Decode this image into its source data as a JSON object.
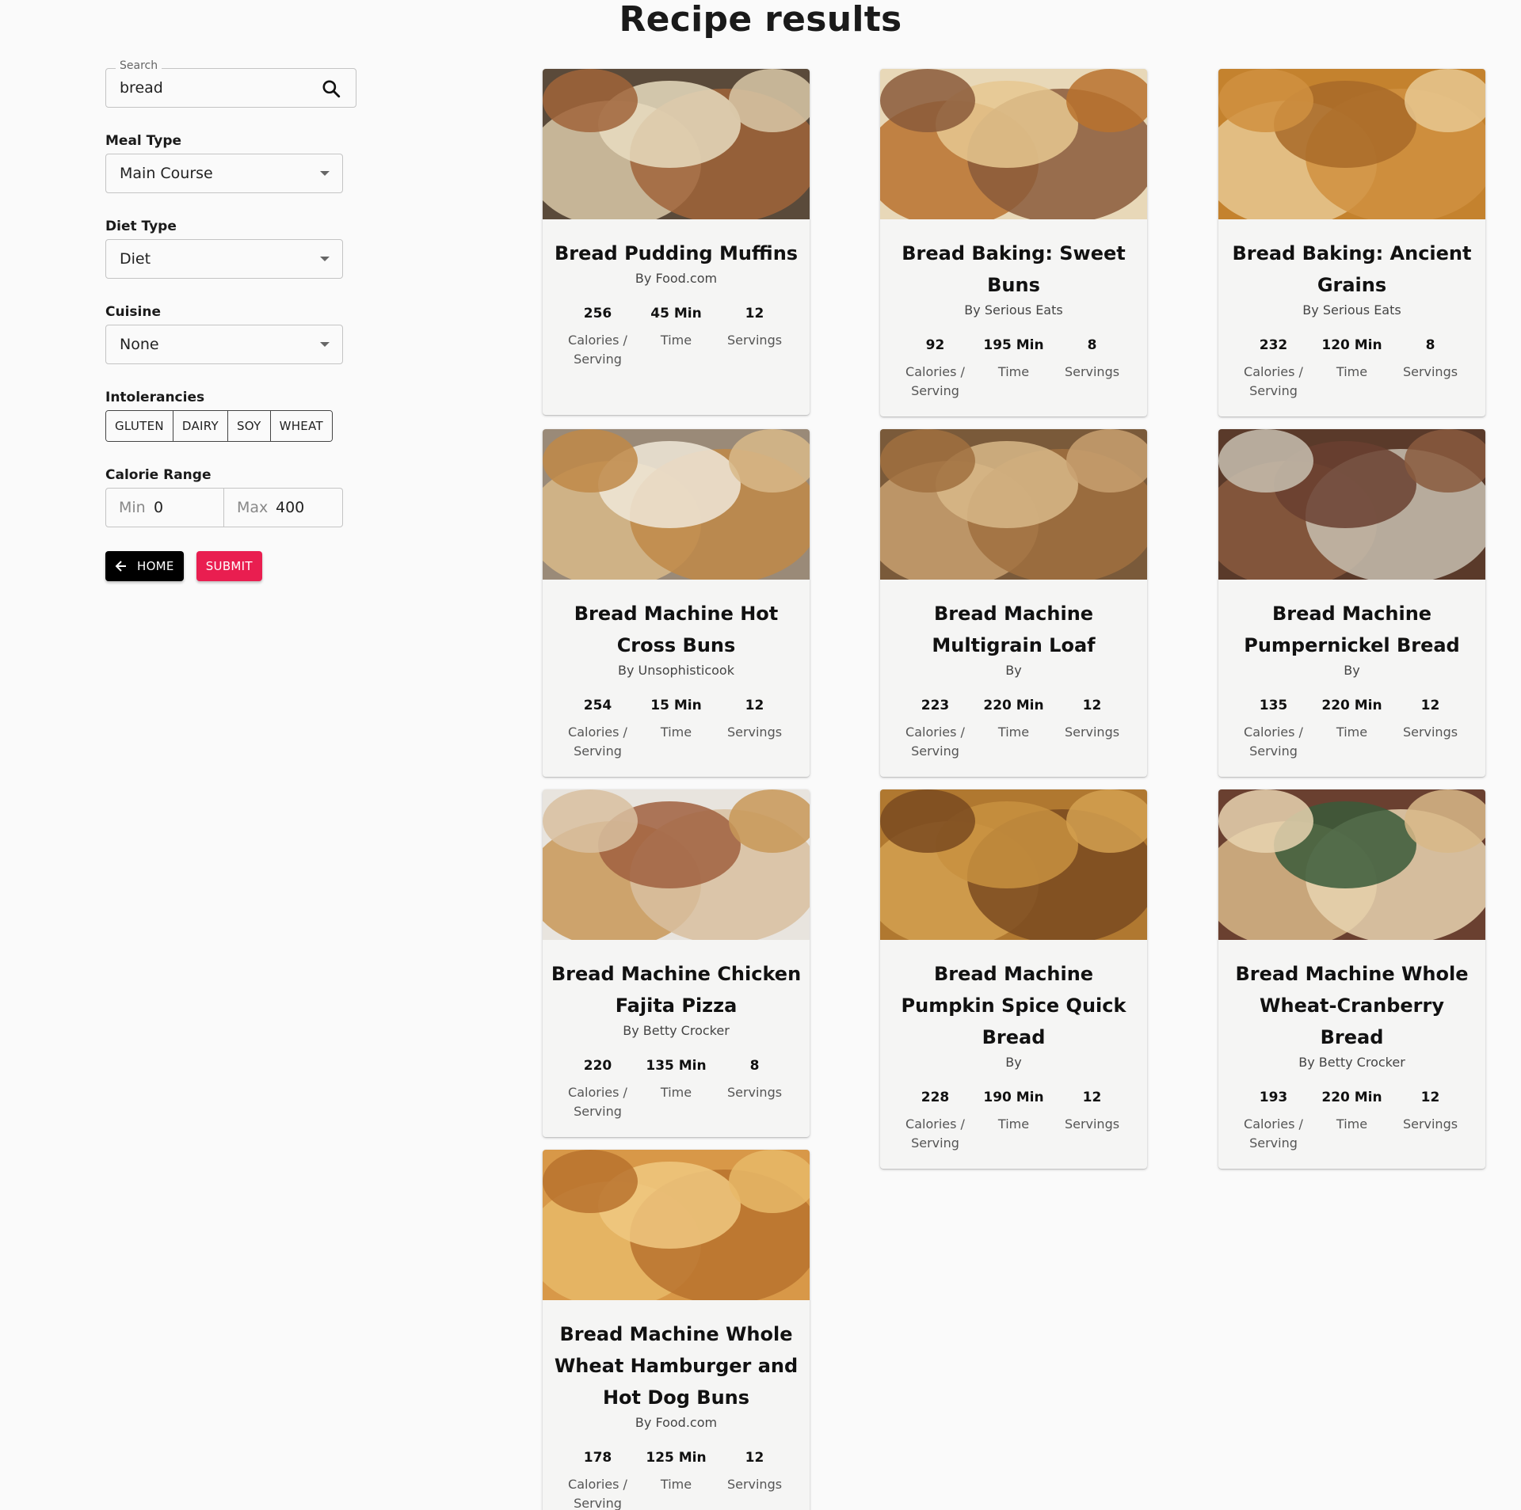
{
  "page": {
    "title": "Recipe results"
  },
  "search": {
    "legend": "Search",
    "value": "bread"
  },
  "filters": {
    "meal_type": {
      "label": "Meal Type",
      "value": "Main Course"
    },
    "diet_type": {
      "label": "Diet Type",
      "value": "Diet"
    },
    "cuisine": {
      "label": "Cuisine",
      "value": "None"
    },
    "intolerances": {
      "label": "Intolerancies",
      "options": [
        "GLUTEN",
        "DAIRY",
        "SOY",
        "WHEAT"
      ]
    },
    "calorie_range": {
      "label": "Calorie Range",
      "min_prefix": "Min",
      "min_value": "0",
      "max_prefix": "Max",
      "max_value": "400"
    }
  },
  "buttons": {
    "home": "HOME",
    "submit": "SUBMIT"
  },
  "stat_labels": {
    "calories": "Calories / Serving",
    "time": "Time",
    "servings": "Servings"
  },
  "recipes": [
    {
      "title": "Bread Pudding Muffins",
      "source": "By Food.com",
      "calories": "256",
      "time": "45 Min",
      "servings": "12"
    },
    {
      "title": "Bread Baking: Sweet Buns",
      "source": "By Serious Eats",
      "calories": "92",
      "time": "195 Min",
      "servings": "8"
    },
    {
      "title": "Bread Baking: Ancient Grains",
      "source": "By Serious Eats",
      "calories": "232",
      "time": "120 Min",
      "servings": "8"
    },
    {
      "title": "Bread Machine Hot Cross Buns",
      "source": "By Unsophisticook",
      "calories": "254",
      "time": "15 Min",
      "servings": "12"
    },
    {
      "title": "Bread Machine Multigrain Loaf",
      "source": "By",
      "calories": "223",
      "time": "220 Min",
      "servings": "12"
    },
    {
      "title": "Bread Machine Pumpernickel Bread",
      "source": "By",
      "calories": "135",
      "time": "220 Min",
      "servings": "12"
    },
    {
      "title": "Bread Machine Chicken Fajita Pizza",
      "source": "By Betty Crocker",
      "calories": "220",
      "time": "135 Min",
      "servings": "8"
    },
    {
      "title": "Bread Machine Pumpkin Spice Quick Bread",
      "source": "By",
      "calories": "228",
      "time": "190 Min",
      "servings": "12"
    },
    {
      "title": "Bread Machine Whole Wheat-Cranberry Bread",
      "source": "By Betty Crocker",
      "calories": "193",
      "time": "220 Min",
      "servings": "12"
    },
    {
      "title": "Bread Machine Whole Wheat Hamburger and Hot Dog Buns",
      "source": "By Food.com",
      "calories": "178",
      "time": "125 Min",
      "servings": "12"
    }
  ],
  "colors": {
    "accent": "#e91e50",
    "home_button": "#000000",
    "background": "#fafafa"
  }
}
